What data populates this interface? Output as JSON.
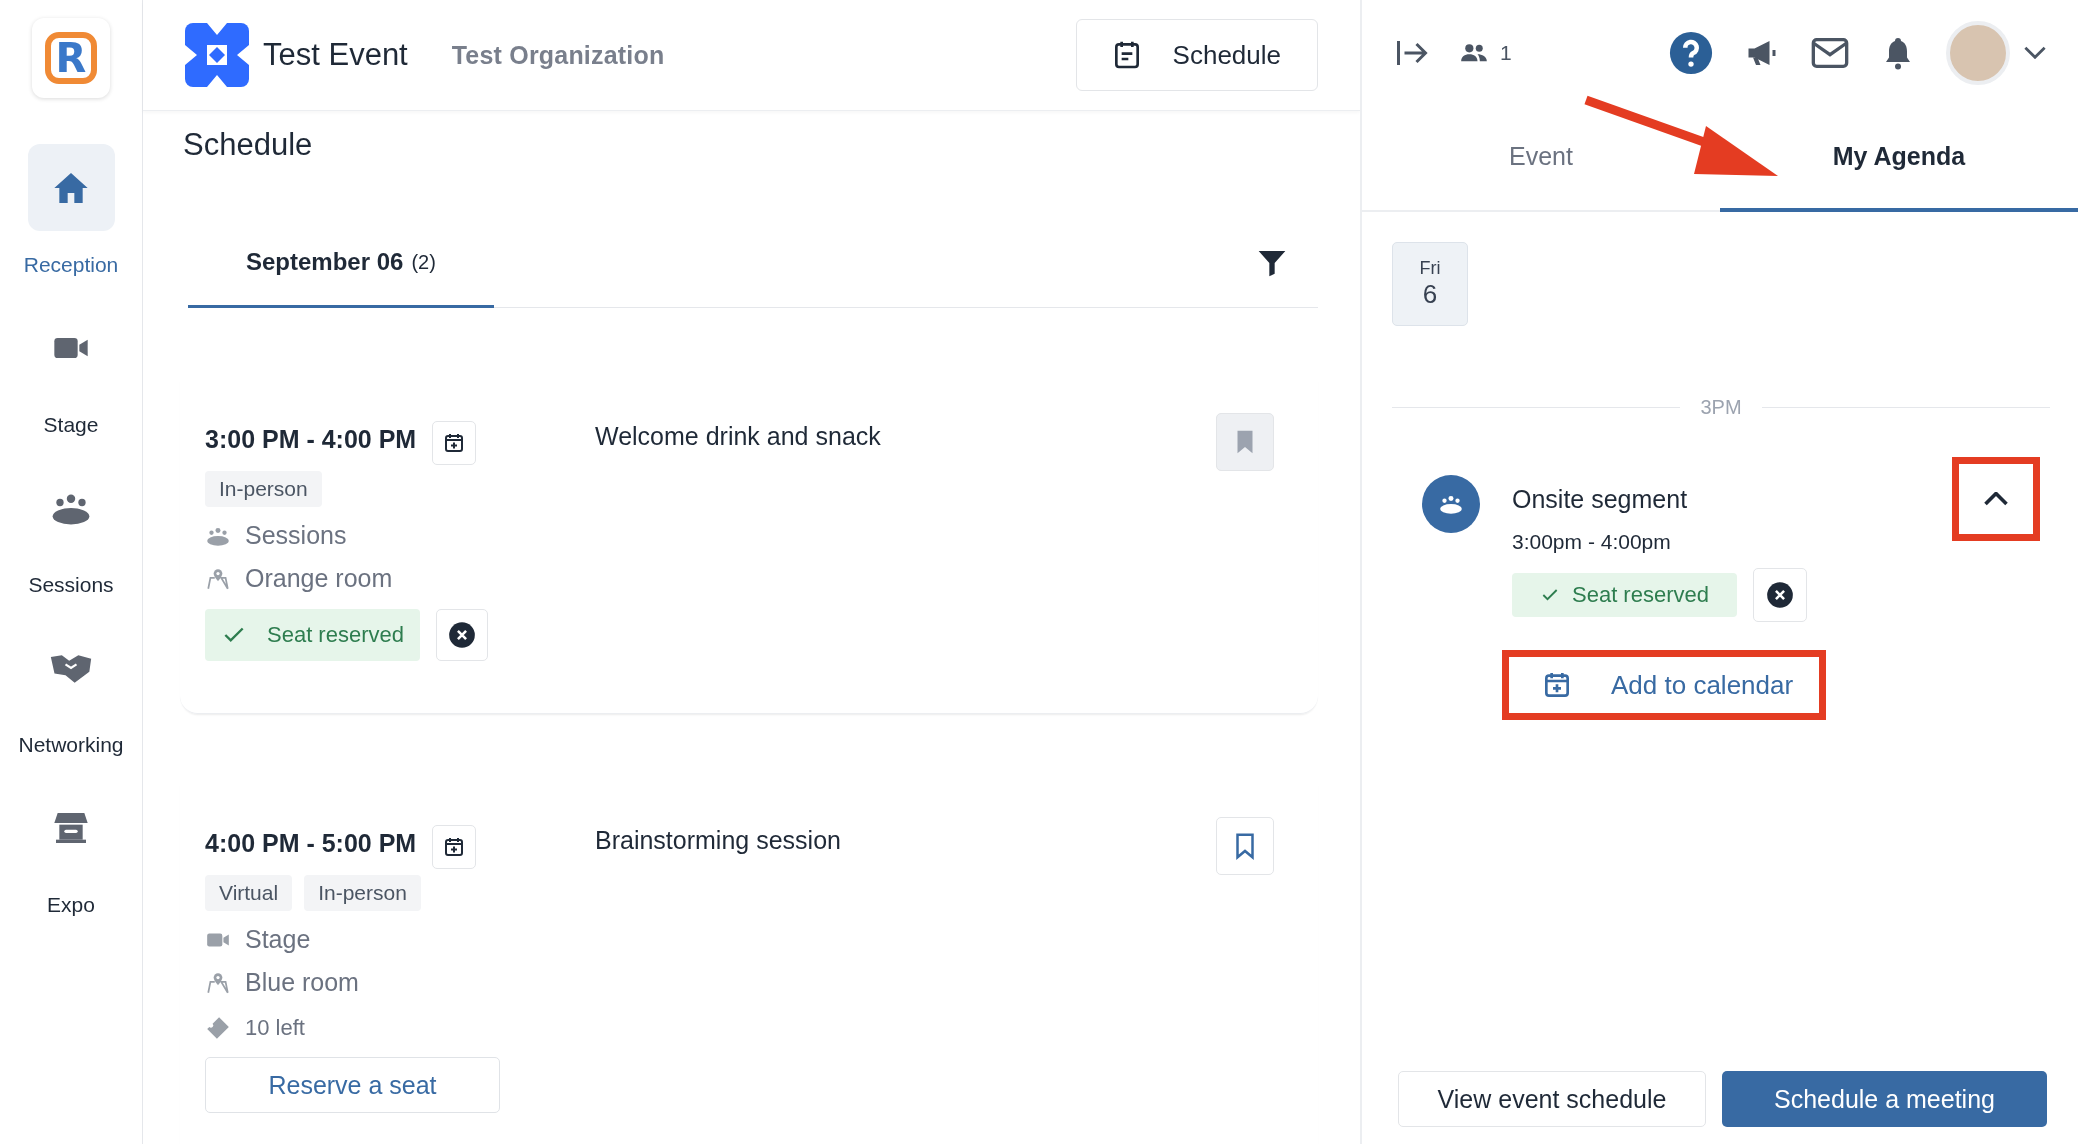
{
  "sidebar": {
    "logo_text": "R",
    "items": [
      {
        "label": "Reception",
        "kind": "home",
        "selected": true
      },
      {
        "label": "Stage",
        "kind": "stage",
        "selected": false
      },
      {
        "label": "Sessions",
        "kind": "sessions",
        "selected": false
      },
      {
        "label": "Networking",
        "kind": "networking",
        "selected": false
      },
      {
        "label": "Expo",
        "kind": "expo",
        "selected": false
      }
    ]
  },
  "header": {
    "event_title": "Test Event",
    "organization": "Test Organization",
    "schedule_button": "Schedule"
  },
  "main": {
    "title": "Schedule",
    "date_tabs": [
      {
        "label": "September 06",
        "count": "(2)",
        "selected": true
      }
    ],
    "sessions": [
      {
        "time": "3:00 PM - 4:00 PM",
        "title": "Welcome drink and snack",
        "bookmarked": true,
        "tags": [
          "In-person"
        ],
        "details": [
          {
            "kind": "sessions",
            "text": "Sessions"
          },
          {
            "kind": "location",
            "text": "Orange room"
          }
        ],
        "seat": {
          "kind": "reserved",
          "label": "Seat reserved"
        }
      },
      {
        "time": "4:00 PM - 5:00 PM",
        "title": "Brainstorming session",
        "bookmarked": false,
        "tags": [
          "Virtual",
          "In-person"
        ],
        "details": [
          {
            "kind": "stage",
            "text": "Stage"
          },
          {
            "kind": "location",
            "text": "Blue room"
          },
          {
            "kind": "tickets",
            "text": "10 left"
          }
        ],
        "seat": {
          "kind": "reserve",
          "label": "Reserve a seat"
        }
      }
    ]
  },
  "right_panel": {
    "attendee_count": "1",
    "tabs": [
      {
        "label": "Event",
        "selected": false
      },
      {
        "label": "My Agenda",
        "selected": true
      }
    ],
    "day": {
      "weekday": "Fri",
      "day": "6"
    },
    "hour_label": "3PM",
    "agenda_items": [
      {
        "title": "Onsite segment",
        "time": "3:00pm - 4:00pm",
        "expanded": true,
        "seat_label": "Seat reserved",
        "add_to_calendar": "Add to calendar"
      }
    ],
    "buttons": [
      {
        "label": "View event schedule",
        "kind": "secondary"
      },
      {
        "label": "Schedule a meeting",
        "kind": "primary"
      }
    ]
  }
}
